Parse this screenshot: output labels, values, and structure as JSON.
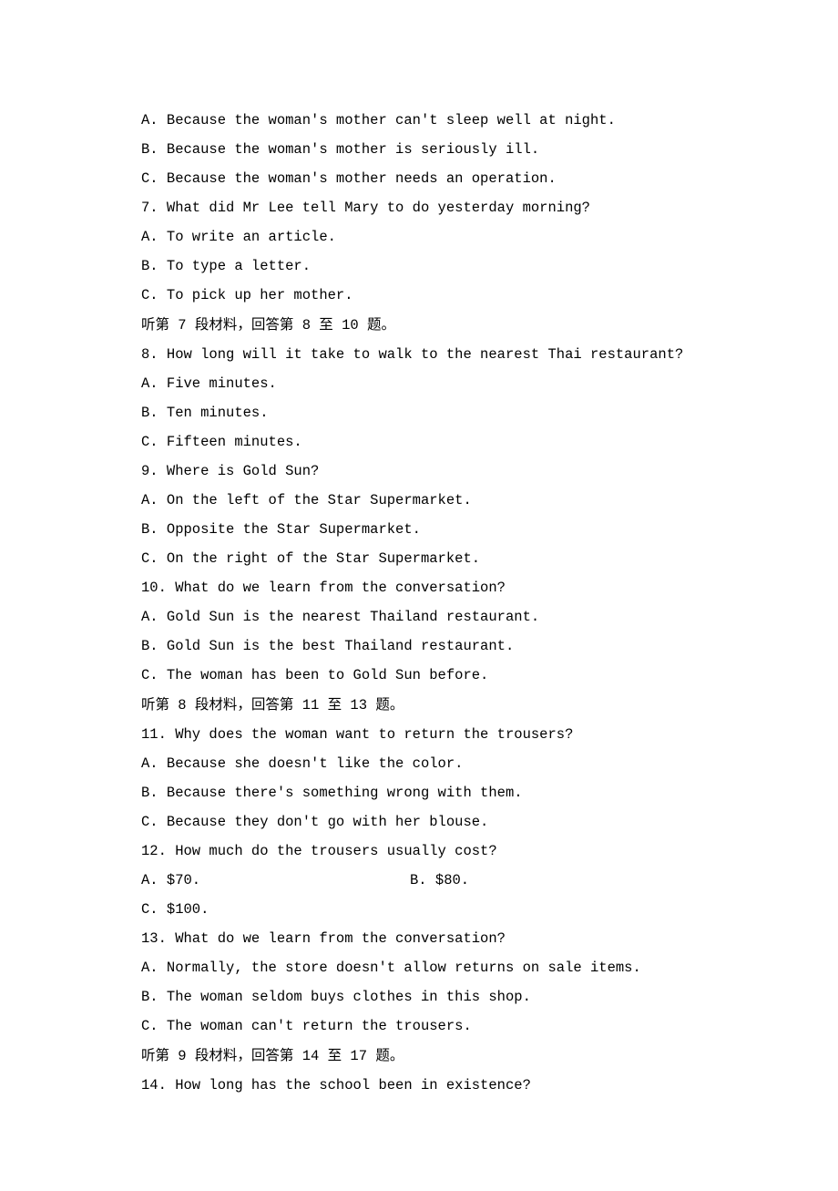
{
  "lines": [
    "A. Because the woman's mother can't sleep well at night.",
    "B. Because the woman's mother is seriously ill.",
    "C. Because the woman's mother needs an operation.",
    "7. What did Mr Lee tell Mary to do yesterday morning?",
    "A. To write an article.",
    "B. To type a letter.",
    "C. To pick up her mother.",
    "听第 7 段材料，回答第 8 至 10 题。",
    "8. How long will it take to walk to the nearest Thai restaurant?",
    "A. Five minutes.",
    "B. Ten minutes.",
    "C. Fifteen minutes.",
    "9. Where is Gold Sun?",
    "A. On the left of the Star Supermarket.",
    "B. Opposite the Star Supermarket.",
    "C. On the right of the Star Supermarket.",
    "10. What do we learn from the conversation?",
    "A. Gold Sun is the nearest Thailand restaurant.",
    "B. Gold Sun is the best Thailand restaurant.",
    "C. The woman has been to Gold Sun before.",
    "听第 8 段材料，回答第 11 至 13 题。",
    "11. Why does the woman want to return the trousers?",
    "A. Because she doesn't like the color.",
    "B. Because there's something wrong with them.",
    "C. Because they don't go with her blouse.",
    "12. How much do the trousers usually cost?"
  ],
  "pair": {
    "a": "A. $70.",
    "b": "B. $80."
  },
  "lines_after": [
    "C. $100.",
    "13. What do we learn from the conversation?",
    "A. Normally, the store doesn't allow returns on sale items.",
    "B. The woman seldom buys clothes in this shop.",
    "C. The woman can't return the trousers.",
    "听第 9 段材料，回答第 14 至 17 题。",
    "14. How long has the school been in existence?"
  ]
}
